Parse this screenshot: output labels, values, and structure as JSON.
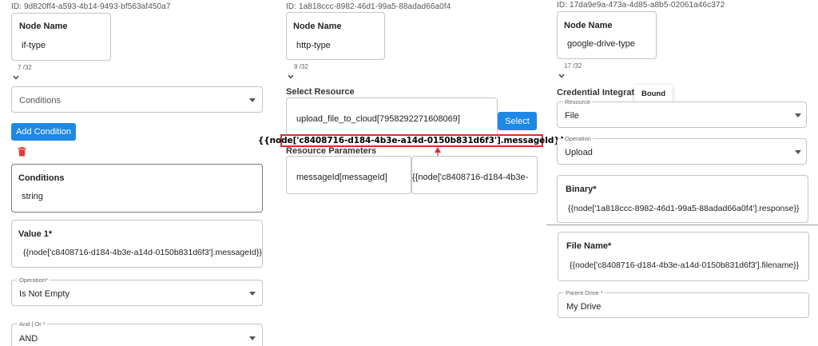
{
  "col1": {
    "id": "ID: 9d820ff4-a593-4b14-9493-bf563af450a7",
    "node_name_title": "Node Name",
    "node_name_value": "if-type",
    "counter": "7 /32",
    "conditions_select": "Conditions",
    "add_condition_label": "Add Condition",
    "conditions_title": "Conditions",
    "conditions_value": "string",
    "value1_title": "Value 1*",
    "value1_value": "{{node['c8408716-d184-4b3e-a14d-0150b831d6f3'].messageId}}",
    "operation_label": "Operation*",
    "operation_value": "Is Not Empty",
    "andor_label": "And | Or *",
    "andor_value": "AND"
  },
  "col2": {
    "id": "ID: 1a818ccc-8982-46d1-99a5-88adad66a0f4",
    "node_name_title": "Node Name",
    "node_name_value": "http-type",
    "counter": "9 /32",
    "select_resource_title": "Select Resource",
    "resource_value": "upload_file_to_cloud[7958292271608069]",
    "select_button_label": "Select",
    "highlight_text": "{{node['c8408716-d184-4b3e-a14d-0150b831d6f3'].messageId}}",
    "resource_params_title": "Resource Parameters",
    "param_name": "messageId[messageId]",
    "param_value": "{{node['c8408716-d184-4b3e-"
  },
  "col3": {
    "id": "ID: 17da9e9a-473a-4d85-a8b5-02061a46c372",
    "node_name_title": "Node Name",
    "node_name_value": "google-drive-type",
    "counter": "17 /32",
    "credential_title": "Credential Integration",
    "bound_badge": "Bound",
    "resource_label": "Resource",
    "resource_value": "File",
    "operation_label": "Operation",
    "operation_value": "Upload",
    "binary_title": "Binary*",
    "binary_value": "{{node['1a818ccc-8982-46d1-99a5-88adad66a0f4'].response}}",
    "filename_title": "File Name*",
    "filename_value": "{{node['c8408716-d184-4b3e-a14d-0150b831d6f3'].filename}}",
    "parent_drive_label": "Parent Drive *",
    "parent_drive_value": "My Drive"
  },
  "colors": {
    "accent": "#1e88e5",
    "delete": "#e53935",
    "highlight_border": "#d32f2f"
  }
}
